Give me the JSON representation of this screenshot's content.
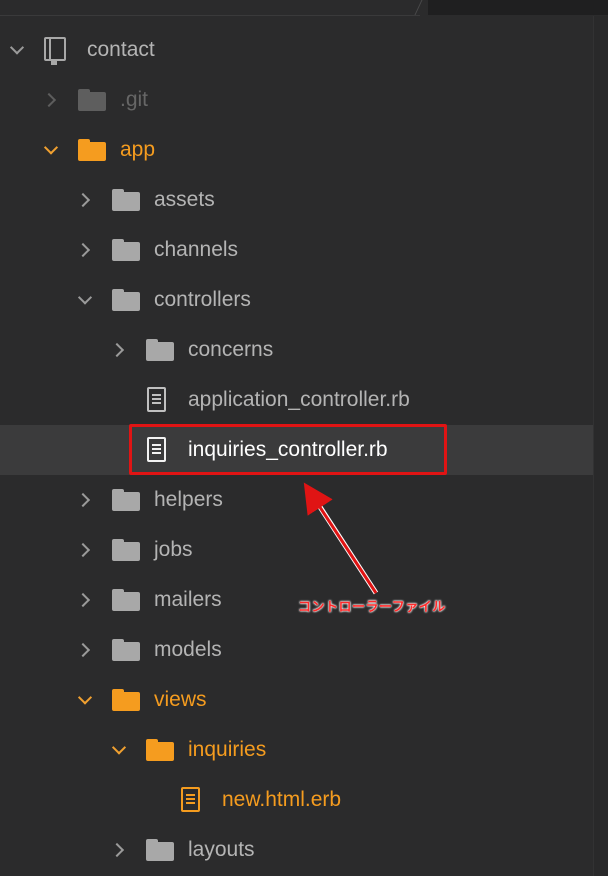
{
  "tree": {
    "root": {
      "label": "contact",
      "icon": "repo-icon"
    },
    "rows": [
      {
        "label": ".git",
        "kind": "folder",
        "state": "collapsed",
        "style": "dim"
      },
      {
        "label": "app",
        "kind": "folder",
        "state": "expanded",
        "style": "modified"
      },
      {
        "label": "assets",
        "kind": "folder",
        "state": "collapsed"
      },
      {
        "label": "channels",
        "kind": "folder",
        "state": "collapsed"
      },
      {
        "label": "controllers",
        "kind": "folder",
        "state": "expanded"
      },
      {
        "label": "concerns",
        "kind": "folder",
        "state": "collapsed"
      },
      {
        "label": "application_controller.rb",
        "kind": "file"
      },
      {
        "label": "inquiries_controller.rb",
        "kind": "file",
        "selected": true
      },
      {
        "label": "helpers",
        "kind": "folder",
        "state": "collapsed"
      },
      {
        "label": "jobs",
        "kind": "folder",
        "state": "collapsed"
      },
      {
        "label": "mailers",
        "kind": "folder",
        "state": "collapsed"
      },
      {
        "label": "models",
        "kind": "folder",
        "state": "collapsed"
      },
      {
        "label": "views",
        "kind": "folder",
        "state": "expanded",
        "style": "modified"
      },
      {
        "label": "inquiries",
        "kind": "folder",
        "state": "expanded",
        "style": "modified"
      },
      {
        "label": "new.html.erb",
        "kind": "file",
        "style": "modified"
      },
      {
        "label": "layouts",
        "kind": "folder",
        "state": "collapsed"
      }
    ]
  },
  "annotation": {
    "text": "コントローラーファイル",
    "color": "#ff2a2a"
  },
  "colors": {
    "background": "#2b2b2c",
    "selected_row": "#3b3b3c",
    "modified": "#f59c1f",
    "highlight": "#e01414"
  }
}
